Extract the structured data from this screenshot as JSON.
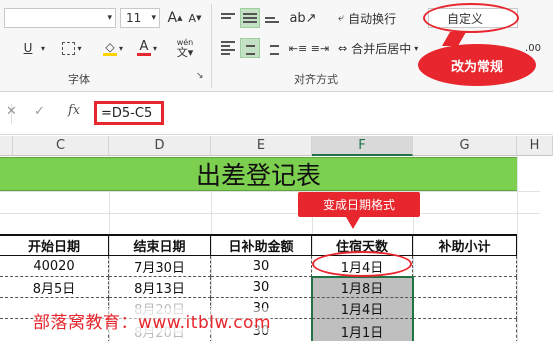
{
  "ribbon": {
    "font_size": "11",
    "font_size_up": "A",
    "font_size_down": "A",
    "underline": "U",
    "font_color_letter": "A",
    "wrap_text": "自动换行",
    "merge_center": "合并后居中",
    "number_format": "自定义",
    "group_font": "字体",
    "group_alignment": "对齐方式",
    "phonetic": "wén"
  },
  "callouts": {
    "change_to_general": "改为常规",
    "becomes_date_format": "变成日期格式"
  },
  "formula_bar": {
    "fx": "fx",
    "formula": "=D5-C5"
  },
  "columns": [
    "C",
    "D",
    "E",
    "F",
    "G",
    "H"
  ],
  "sheet": {
    "title": "出差登记表",
    "headers": [
      "开始日期",
      "结束日期",
      "日补助金额",
      "住宿天数",
      "补助小计"
    ],
    "rows": [
      [
        "40020",
        "7月30日",
        "30",
        "1月4日",
        ""
      ],
      [
        "8月5日",
        "8月13日",
        "30",
        "1月8日",
        ""
      ],
      [
        "",
        "8月20日",
        "30",
        "1月4日",
        ""
      ],
      [
        "",
        "8月20日",
        "30",
        "1月1日",
        ""
      ]
    ]
  },
  "watermark": "部落窝教育：www.itblw.com",
  "colors": {
    "title_fill": "#7ccf4f",
    "accent_red": "#e8262d",
    "selection_fill": "#bfbfbf",
    "excel_green": "#217346"
  }
}
